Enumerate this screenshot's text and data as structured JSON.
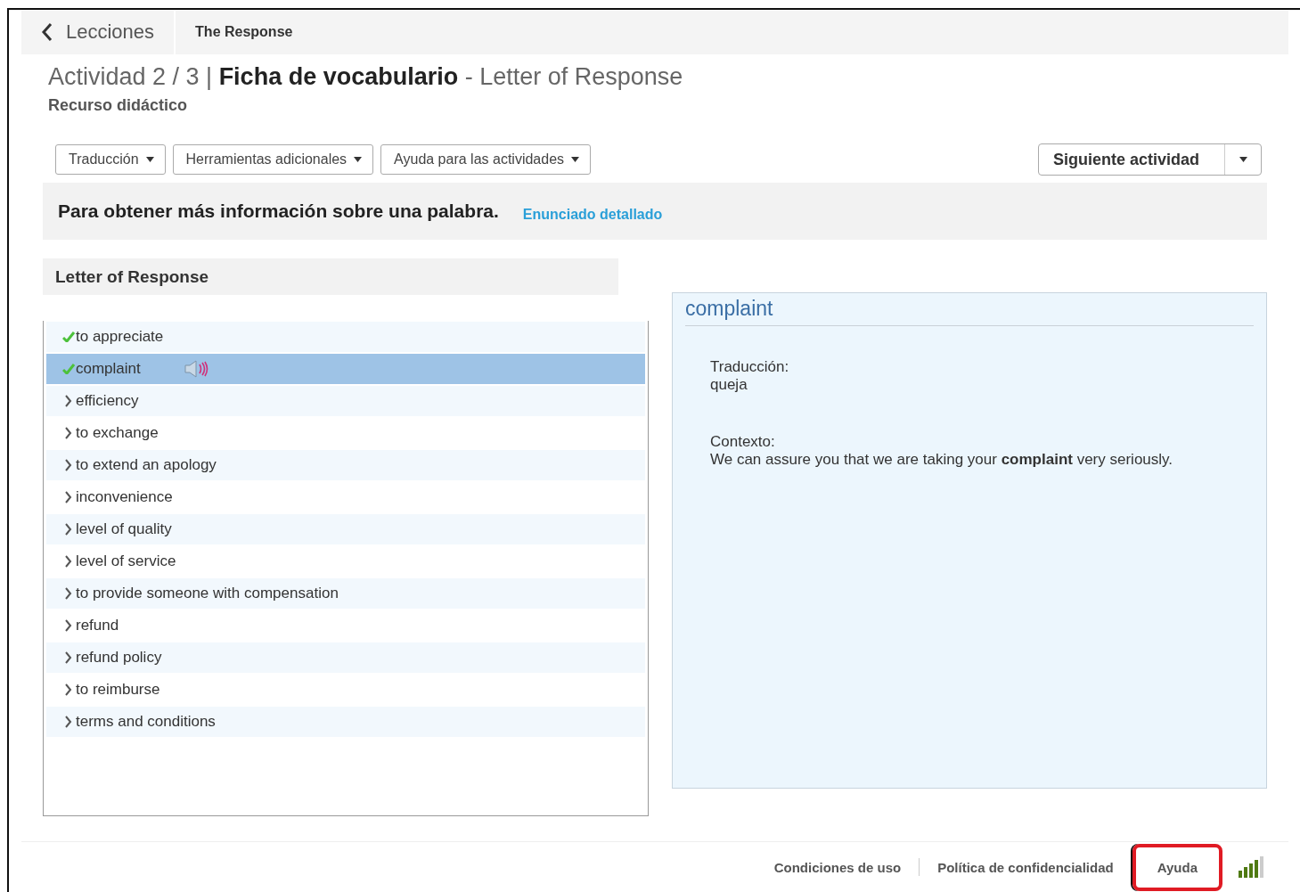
{
  "nav": {
    "back_label": "Lecciones",
    "lesson": "The Response"
  },
  "header": {
    "title": "Actividad 2 / 3 | **Ficha de vocabulario** - Letter of Response",
    "resource": "Recurso didáctico"
  },
  "toolbar": {
    "dropdowns": [
      "Traducción",
      "Herramientas adicionales",
      "Ayuda para las actividades"
    ],
    "next_button": "Siguiente actividad"
  },
  "instructions": {
    "text": "Para obtener más información sobre una palabra.",
    "link": "Enunciado detallado"
  },
  "word_list": {
    "title": "Letter of Response",
    "items": [
      {
        "label": "to appreciate",
        "checked": true,
        "selected": false
      },
      {
        "label": "complaint",
        "checked": true,
        "selected": true
      },
      {
        "label": "efficiency",
        "checked": false,
        "selected": false
      },
      {
        "label": "to exchange",
        "checked": false,
        "selected": false
      },
      {
        "label": "to extend an apology",
        "checked": false,
        "selected": false
      },
      {
        "label": "inconvenience",
        "checked": false,
        "selected": false
      },
      {
        "label": "level of quality",
        "checked": false,
        "selected": false
      },
      {
        "label": "level of service",
        "checked": false,
        "selected": false
      },
      {
        "label": "to provide someone with compensation",
        "checked": false,
        "selected": false
      },
      {
        "label": "refund",
        "checked": false,
        "selected": false
      },
      {
        "label": "refund policy",
        "checked": false,
        "selected": false
      },
      {
        "label": "to reimburse",
        "checked": false,
        "selected": false
      },
      {
        "label": "terms and conditions",
        "checked": false,
        "selected": false
      }
    ]
  },
  "detail": {
    "word": "complaint",
    "translation_label": "Traducción:",
    "translation": "queja",
    "context_label": "Contexto:",
    "context": "We can assure you that we are taking your **complaint** very seriously."
  },
  "footer": {
    "links": [
      {
        "label": "Condiciones de uso",
        "highlighted": false
      },
      {
        "label": "Política de confidencialidad",
        "highlighted": false
      },
      {
        "label": "Ayuda",
        "highlighted": true
      }
    ]
  }
}
